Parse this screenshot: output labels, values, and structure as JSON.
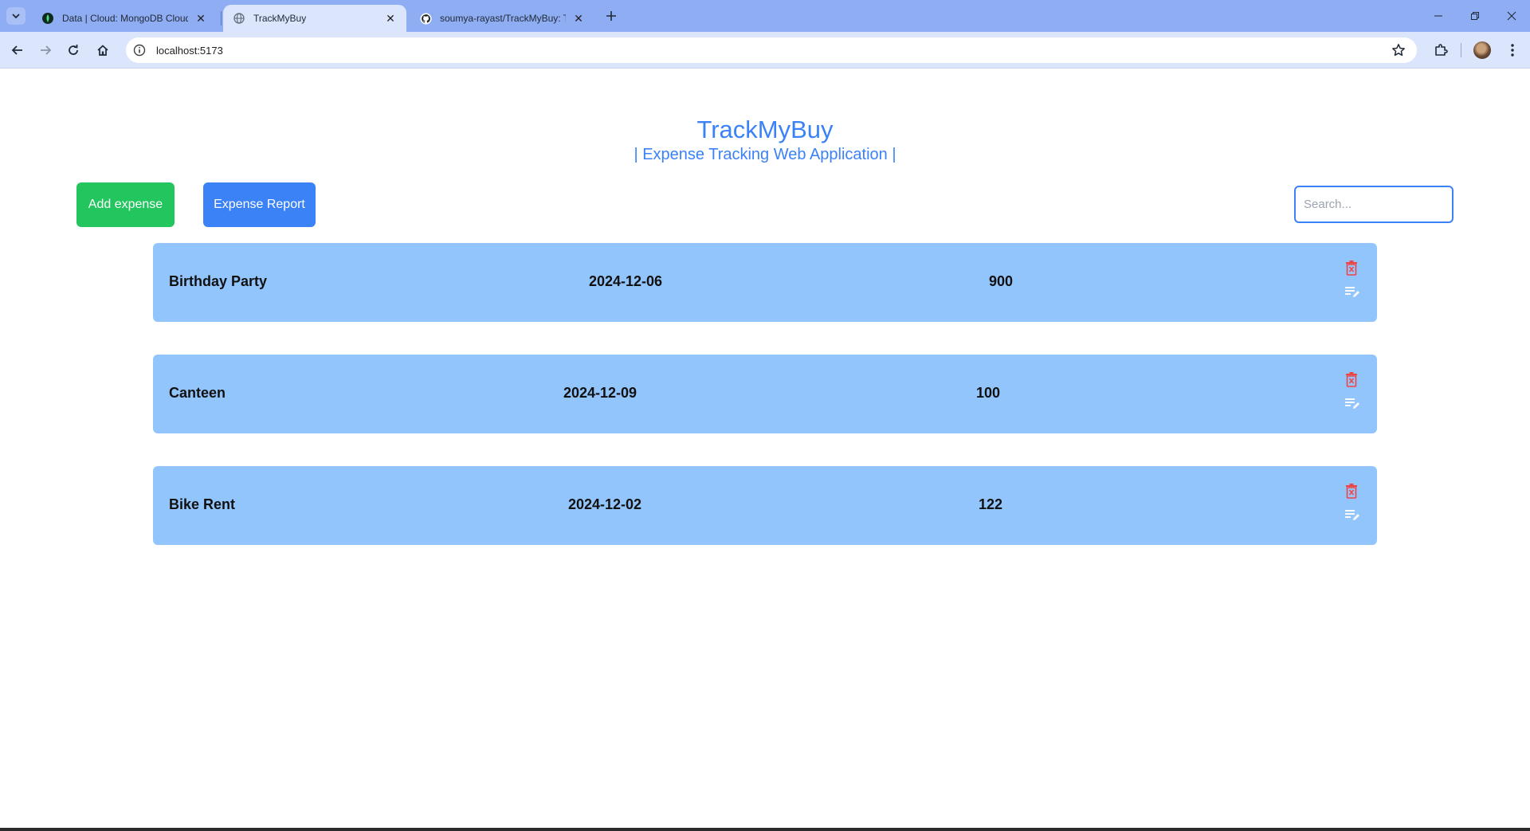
{
  "browser": {
    "tabs": [
      {
        "title": "Data | Cloud: MongoDB Cloud",
        "icon": "mongodb-leaf-icon",
        "active": false
      },
      {
        "title": "TrackMyBuy",
        "icon": "globe-icon",
        "active": true
      },
      {
        "title": "soumya-rayast/TrackMyBuy: Tra",
        "icon": "github-icon",
        "active": false
      }
    ],
    "url": "localhost:5173"
  },
  "app": {
    "title": "TrackMyBuy",
    "subtitle": "| Expense Tracking Web Application |",
    "add_button": "Add expense",
    "report_button": "Expense Report",
    "search_placeholder": "Search...",
    "accent_color": "#3b82f6",
    "add_color": "#22c55e",
    "card_color": "#93c5fd",
    "delete_color": "#ef4444"
  },
  "expenses": [
    {
      "name": "Birthday Party",
      "date": "2024-12-06",
      "amount": "900"
    },
    {
      "name": "Canteen",
      "date": "2024-12-09",
      "amount": "100"
    },
    {
      "name": "Bike Rent",
      "date": "2024-12-02",
      "amount": "122"
    }
  ]
}
